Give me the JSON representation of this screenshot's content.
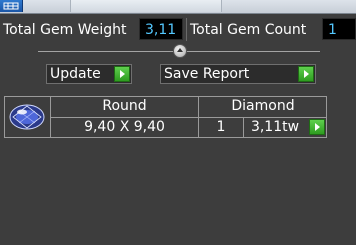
{
  "stats": {
    "total_weight_label": "Total Gem Weight",
    "total_weight_value": "3,11",
    "total_count_label": "Total Gem Count",
    "total_count_value": "1"
  },
  "actions": {
    "update_label": "Update",
    "save_report_label": "Save Report"
  },
  "gem": {
    "shape": "Round",
    "stone": "Diamond",
    "dimensions": "9,40 X 9,40",
    "quantity": "1",
    "weight": "3,11tw"
  },
  "icons": {
    "app": "app-icon",
    "slider": "slider-handle-icon",
    "action_arrow": "green-play-arrow-icon",
    "gem_thumbnail": "round-diamond-icon"
  },
  "colors": {
    "panel_background": "#3d3d3d",
    "value_text": "#54c8ff",
    "arrow_green": "#3fb32d"
  }
}
